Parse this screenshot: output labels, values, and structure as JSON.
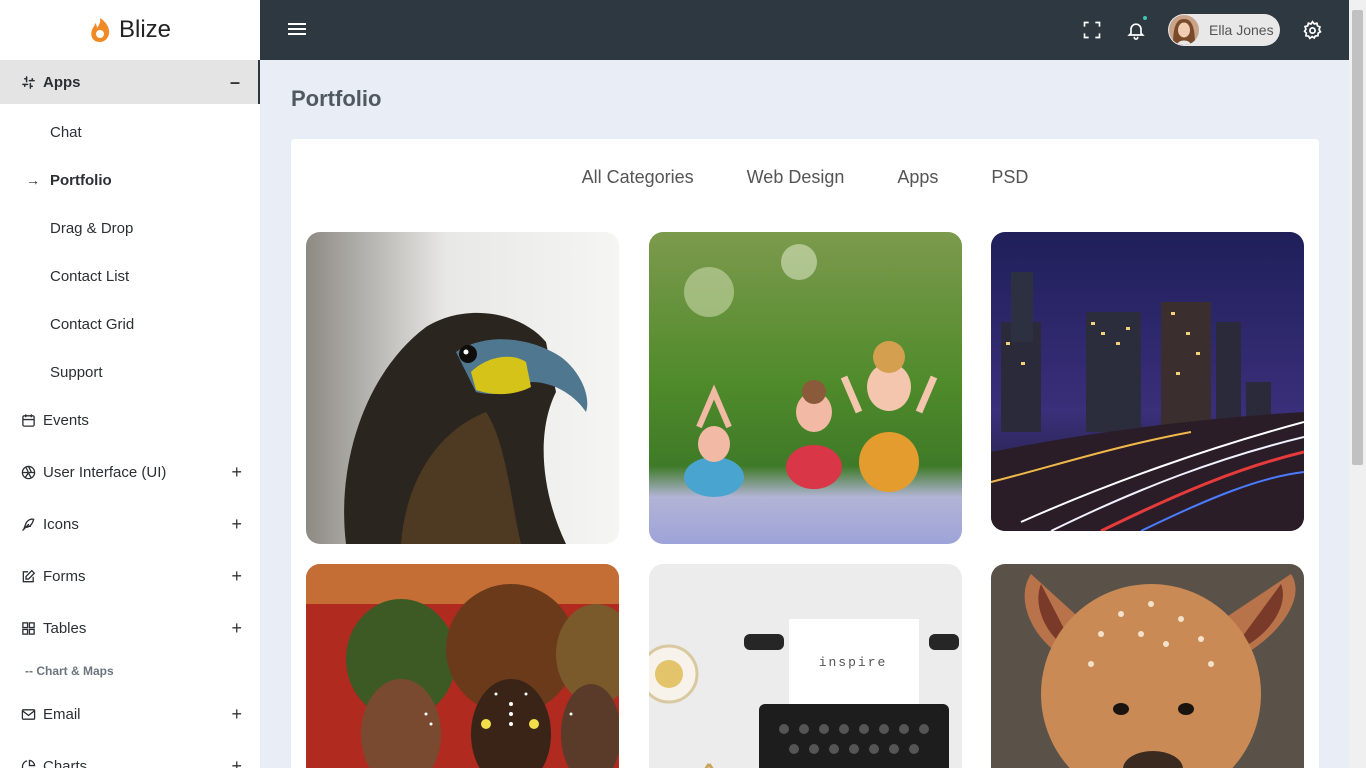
{
  "brand": {
    "name": "Blize",
    "accent": "#f08a24"
  },
  "sidebar": {
    "apps": {
      "label": "Apps",
      "toggle": "–"
    },
    "sub_items": [
      {
        "label": "Chat"
      },
      {
        "label": "Portfolio",
        "active": true,
        "marker": "→"
      },
      {
        "label": "Drag & Drop"
      },
      {
        "label": "Contact List"
      },
      {
        "label": "Contact Grid"
      },
      {
        "label": "Support"
      }
    ],
    "items": [
      {
        "label": "Events",
        "icon": "calendar-icon"
      },
      {
        "label": "User Interface (UI)",
        "icon": "aperture-icon",
        "toggle": "+"
      },
      {
        "label": "Icons",
        "icon": "feather-icon",
        "toggle": "+"
      },
      {
        "label": "Forms",
        "icon": "edit-icon",
        "toggle": "+"
      },
      {
        "label": "Tables",
        "icon": "grid-icon",
        "toggle": "+"
      }
    ],
    "section": "-- Chart & Maps",
    "items2": [
      {
        "label": "Email",
        "icon": "mail-icon",
        "toggle": "+"
      },
      {
        "label": "Charts",
        "icon": "pie-chart-icon",
        "toggle": "+"
      }
    ]
  },
  "topbar": {
    "user_name": "Ella Jones",
    "colors": {
      "bg": "#2e3841",
      "notif": "#3ec6b3"
    }
  },
  "page": {
    "title": "Portfolio",
    "filters": [
      "All Categories",
      "Web Design",
      "Apps",
      "PSD"
    ]
  },
  "gallery": {
    "tiles": [
      {
        "subject": "eagle"
      },
      {
        "subject": "figurines"
      },
      {
        "subject": "city-night"
      },
      {
        "subject": "women-headwraps"
      },
      {
        "subject": "typewriter",
        "caption": "inspire"
      },
      {
        "subject": "deer"
      }
    ]
  }
}
